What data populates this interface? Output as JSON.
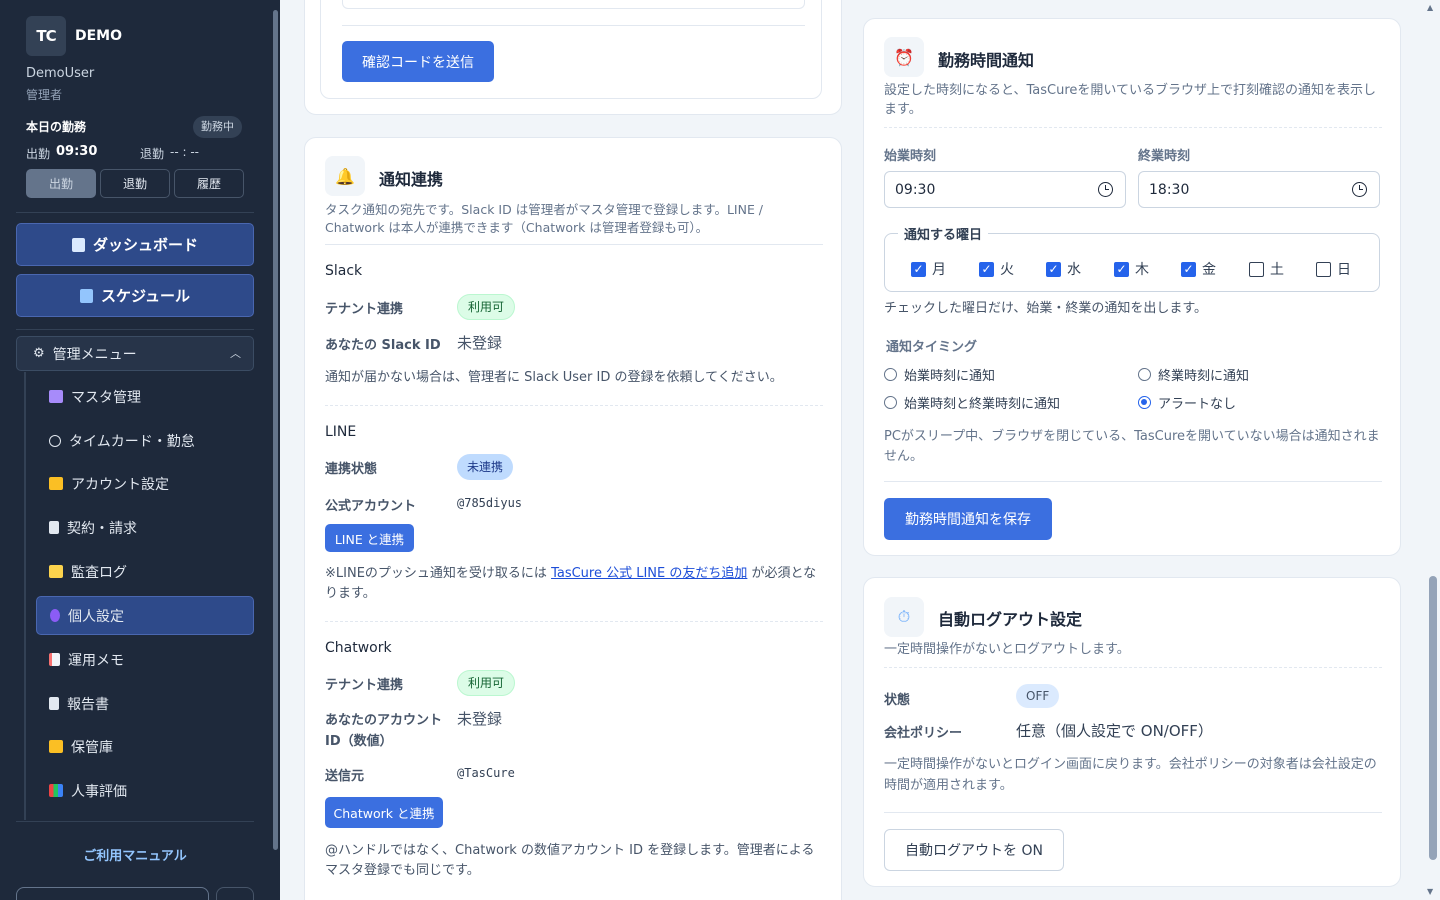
{
  "sidebar": {
    "logo_text": "TC",
    "brand": "DEMO",
    "user_name": "DemoUser",
    "user_role": "管理者",
    "today_label": "本日の勤務",
    "status_badge": "勤務中",
    "clock_in_label": "出勤",
    "clock_in_time": "09:30",
    "clock_out_label": "退勤",
    "clock_out_time": "-- : --",
    "buttons": {
      "clock_in": "出勤",
      "clock_out": "退勤",
      "history": "履歴"
    },
    "dashboard": "ダッシュボード",
    "schedule": "スケジュール",
    "admin_menu": "管理メニュー",
    "items": [
      {
        "label": "マスタ管理",
        "icon": "people-icon"
      },
      {
        "label": "タイムカード・勤怠",
        "icon": "stopwatch-icon"
      },
      {
        "label": "アカウント設定",
        "icon": "key-icon"
      },
      {
        "label": "契約・請求",
        "icon": "receipt-icon"
      },
      {
        "label": "監査ログ",
        "icon": "scroll-icon"
      },
      {
        "label": "個人設定",
        "icon": "person-icon"
      },
      {
        "label": "運用メモ",
        "icon": "memo-icon"
      },
      {
        "label": "報告書",
        "icon": "document-icon"
      },
      {
        "label": "保管庫",
        "icon": "folder-icon"
      },
      {
        "label": "人事評価",
        "icon": "bar-chart-icon"
      }
    ],
    "manual_link": "ご利用マニュアル"
  },
  "verify": {
    "send_code_button": "確認コードを送信"
  },
  "notify": {
    "title": "通知連携",
    "icon": "bell-icon",
    "description": "タスク通知の宛先です。Slack ID は管理者がマスタ管理で登録します。LINE / Chatwork は本人が連携できます（Chatwork は管理者登録も可）。",
    "slack": {
      "heading": "Slack",
      "tenant_label": "テナント連携",
      "tenant_status": "利用可",
      "id_label": "あなたの Slack ID",
      "id_value": "未登録",
      "note": "通知が届かない場合は、管理者に Slack User ID の登録を依頼してください。"
    },
    "line": {
      "heading": "LINE",
      "status_label": "連携状態",
      "status_value": "未連携",
      "account_label": "公式アカウント",
      "account_value": "@785diyus",
      "link_button": "LINE と連携",
      "note_prefix": "※LINEのプッシュ通知を受け取るには",
      "note_link": "TasCure 公式 LINE の友だち追加",
      "note_suffix": "が必須となります。"
    },
    "chatwork": {
      "heading": "Chatwork",
      "tenant_label": "テナント連携",
      "tenant_status": "利用可",
      "id_label": "あなたのアカウント ID（数値）",
      "id_value": "未登録",
      "sender_label": "送信元",
      "sender_value": "@TasCure",
      "link_button": "Chatwork と連携",
      "note": "@ハンドルではなく、Chatwork の数値アカウント ID を登録します。管理者によるマスタ登録でも同じです。"
    }
  },
  "worktime": {
    "title": "勤務時間通知",
    "icon": "alarm-clock-icon",
    "description": "設定した時刻になると、TasCureを開いているブラウザ上で打刻確認の通知を表示します。",
    "start_label": "始業時刻",
    "start_value": "09:30",
    "end_label": "終業時刻",
    "end_value": "18:30",
    "days_legend": "通知する曜日",
    "days": [
      {
        "label": "月",
        "checked": true
      },
      {
        "label": "火",
        "checked": true
      },
      {
        "label": "水",
        "checked": true
      },
      {
        "label": "木",
        "checked": true
      },
      {
        "label": "金",
        "checked": true
      },
      {
        "label": "土",
        "checked": false
      },
      {
        "label": "日",
        "checked": false
      }
    ],
    "days_note": "チェックした曜日だけ、始業・終業の通知を出します。",
    "timing_label": "通知タイミング",
    "timing_options": [
      {
        "label": "始業時刻に通知",
        "selected": false
      },
      {
        "label": "終業時刻に通知",
        "selected": false
      },
      {
        "label": "始業時刻と終業時刻に通知",
        "selected": false
      },
      {
        "label": "アラートなし",
        "selected": true
      }
    ],
    "sleep_note": "PCがスリープ中、ブラウザを閉じている、TasCureを開いていない場合は通知されません。",
    "save_button": "勤務時間通知を保存"
  },
  "autologout": {
    "title": "自動ログアウト設定",
    "icon": "timer-icon",
    "description": "一定時間操作がないとログアウトします。",
    "status_label": "状態",
    "status_value": "OFF",
    "policy_label": "会社ポリシー",
    "policy_value": "任意（個人設定で ON/OFF）",
    "note": "一定時間操作がないとログイン画面に戻ります。会社ポリシーの対象者は会社設定の時間が適用されます。",
    "toggle_button": "自動ログアウトを ON"
  }
}
